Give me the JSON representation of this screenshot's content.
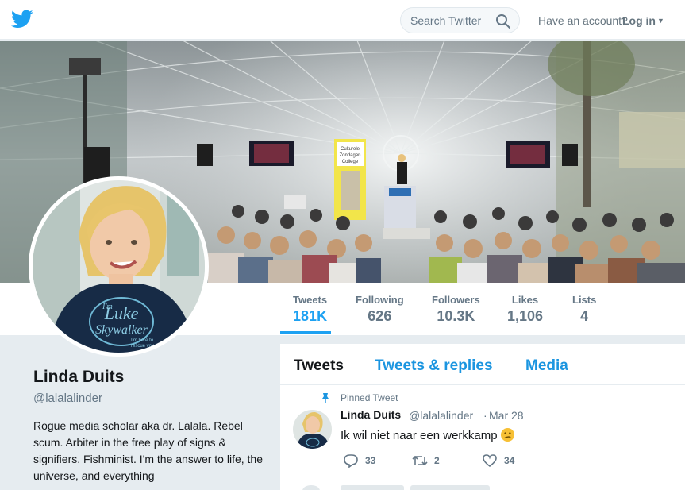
{
  "header": {
    "logo": "twitter-bird-icon",
    "search_placeholder": "Search Twitter",
    "account_prompt": "Have an account?",
    "login_label": "Log in"
  },
  "profile": {
    "name": "Linda Duits",
    "handle": "@lalalalinder",
    "bio": "Rogue media scholar aka dr. Lalala. Rebel scum. Arbiter in the free play of signs & signifiers. Fishminist. I'm the answer to life, the universe, and everything",
    "banner_sign": [
      "Culturele",
      "Zondagen",
      "College"
    ],
    "shirt_text": [
      "I'm",
      "Luke",
      "Skywalker",
      "I'm here to",
      "rescue you"
    ]
  },
  "stats": [
    {
      "label": "Tweets",
      "value": "181K"
    },
    {
      "label": "Following",
      "value": "626"
    },
    {
      "label": "Followers",
      "value": "10.3K"
    },
    {
      "label": "Likes",
      "value": "1,106"
    },
    {
      "label": "Lists",
      "value": "4"
    }
  ],
  "timeline": {
    "tabs": [
      "Tweets",
      "Tweets & replies",
      "Media"
    ],
    "pinned_label": "Pinned Tweet",
    "tweet": {
      "name": "Linda Duits",
      "handle": "@lalalalinder",
      "separator": "·",
      "date": "Mar 28",
      "text": "Ik wil niet naar een werkkamp",
      "replies": "33",
      "retweets": "2",
      "likes": "34"
    }
  },
  "colors": {
    "brand": "#1da1f2",
    "link": "#1b95e0",
    "muted": "#657786",
    "background": "#e6ecf0"
  }
}
